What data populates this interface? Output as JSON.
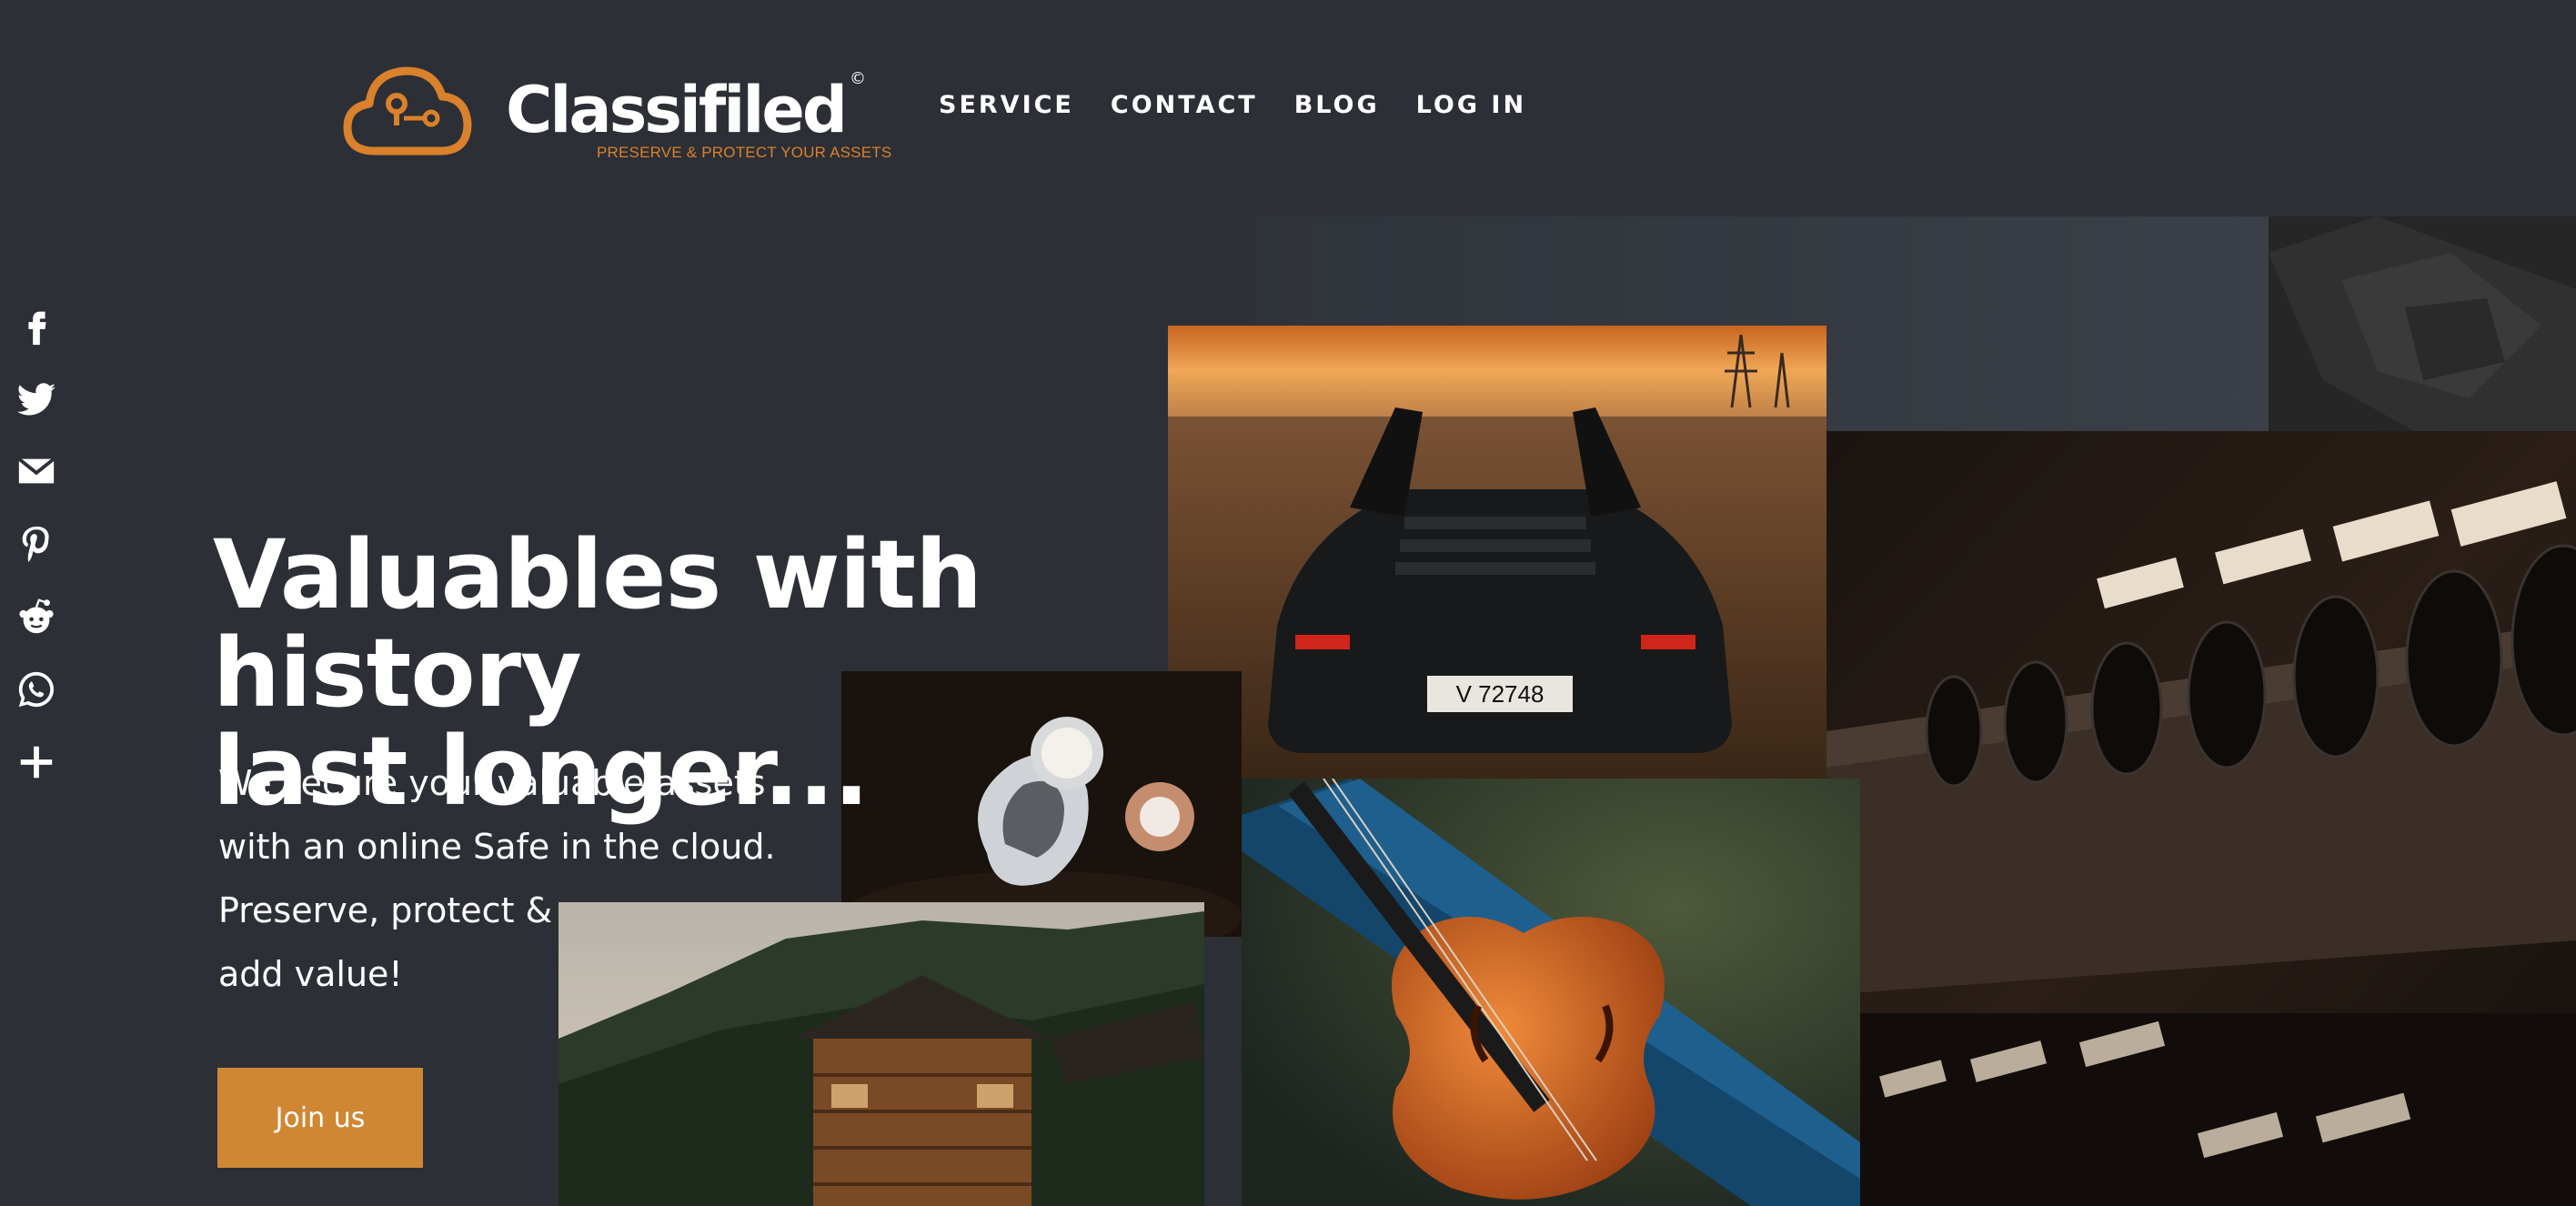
{
  "brand": {
    "name": "Classifiled",
    "copyright": "©",
    "tagline": "PRESERVE & PROTECT YOUR ASSETS",
    "accent_color": "#d9812b"
  },
  "nav": {
    "items": [
      {
        "label": "SERVICE"
      },
      {
        "label": "CONTACT"
      },
      {
        "label": "BLOG"
      },
      {
        "label": "LOG IN"
      }
    ]
  },
  "social": {
    "icons": [
      "facebook-icon",
      "twitter-icon",
      "email-icon",
      "pinterest-icon",
      "reddit-icon",
      "whatsapp-icon",
      "plus-icon"
    ]
  },
  "hero": {
    "title_line1": "Valuables with history",
    "title_line2": "last longer...",
    "subtitle_line1": "We secure your valuable assets",
    "subtitle_line2": "with an online Safe in the cloud.",
    "subtitle_line3": "Preserve, protect &",
    "subtitle_line4": "add value!",
    "cta_label": "Join us",
    "cta_color": "#cf8733"
  },
  "collage": {
    "car_plate": "V 72748"
  },
  "colors": {
    "background": "#2c2f36",
    "text": "#ffffff"
  }
}
